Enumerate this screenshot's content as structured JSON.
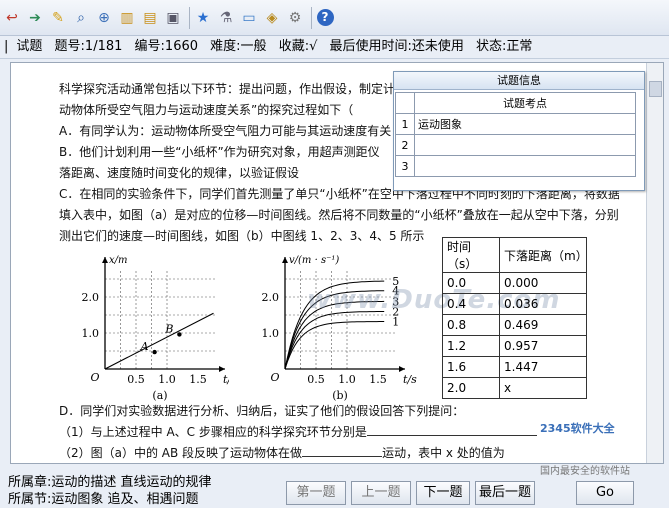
{
  "toolbar": {
    "icons": [
      "exit-icon",
      "next-icon",
      "edit-icon",
      "search-icon",
      "zoom-icon",
      "books-icon",
      "book-icon",
      "copy-icon",
      "star-icon",
      "tool-icon",
      "monitor-icon",
      "box-icon",
      "gear-icon",
      "help-icon"
    ]
  },
  "infobar": {
    "type": "试题",
    "number": "题号:1/181",
    "id": "编号:1660",
    "difficulty": "难度:一般",
    "favorite": "收藏:√",
    "last_used": "最后使用时间:还未使用",
    "state": "状态:正常"
  },
  "question": {
    "lines": [
      "科学探究活动通常包括以下环节：提出问题，作出假设，制定计",
      "动物体所受空气阻力与运动速度关系”的探究过程如下（",
      "A．有同学认为：运动物体所受空气阻力可能与其运动速度有关",
      "B．他们计划利用一些“小纸杯”作为研究对象，用超声测距仪",
      "落距离、速度随时间变化的规律，以验证假设",
      "C．在相同的实验条件下，同学们首先测量了单只“小纸杯”在空中下落过程中不同时刻的下落距离，将数据",
      "填入表中，如图（a）是对应的位移—时间图线。然后将不同数量的“小纸杯”叠放在一起从空中下落，分别",
      "测出它们的速度—时间图线，如图（b）中图线 1、2、3、4、5 所示"
    ],
    "tail_lines": [
      "D．同学们对实验数据进行分析、归纳后，证实了他们的假设回答下列提问：",
      "（1）与上述过程中 A、C 步骤相应的科学探究环节分别是",
      "（2）图（a）中的 AB 段反映了运动物体在做",
      "运动，表中 x 处的值为"
    ]
  },
  "popup": {
    "title": "试题信息",
    "header": "试题考点",
    "rows": [
      {
        "n": "1",
        "v": "运动图象"
      },
      {
        "n": "2",
        "v": ""
      },
      {
        "n": "3",
        "v": ""
      }
    ]
  },
  "data_table": {
    "headers": [
      "时间（s）",
      "下落距离（m）"
    ],
    "rows": [
      [
        "0.0",
        "0.000"
      ],
      [
        "0.4",
        "0.036"
      ],
      [
        "0.8",
        "0.469"
      ],
      [
        "1.2",
        "0.957"
      ],
      [
        "1.6",
        "1.447"
      ],
      [
        "2.0",
        "x"
      ]
    ]
  },
  "chart_data": [
    {
      "type": "line",
      "caption": "(a)",
      "ylabel": "x/m",
      "xlabel": "t/s",
      "xticks": [
        "0.5",
        "1.0",
        "1.5"
      ],
      "yticks": [
        "1.0",
        "2.0"
      ],
      "origin": "O",
      "points": [
        {
          "name": "A",
          "x": 0.8,
          "y": 0.47
        },
        {
          "name": "B",
          "x": 1.2,
          "y": 0.96
        }
      ],
      "line": {
        "x": [
          0.0,
          1.75
        ],
        "y": [
          0.0,
          1.55
        ]
      }
    },
    {
      "type": "line",
      "caption": "(b)",
      "ylabel": "v/(m · s⁻¹)",
      "xlabel": "t/s",
      "xticks": [
        "0.5",
        "1.0",
        "1.5"
      ],
      "yticks": [
        "1.0",
        "2.0"
      ],
      "origin": "O",
      "series": [
        {
          "name": "1",
          "plateau": 1.32
        },
        {
          "name": "2",
          "plateau": 1.6
        },
        {
          "name": "3",
          "plateau": 1.88
        },
        {
          "name": "4",
          "plateau": 2.18
        },
        {
          "name": "5",
          "plateau": 2.45
        }
      ]
    }
  ],
  "watermark": "www.DuoTe.com",
  "logo": "2345软件大全",
  "logo_sub": "国内最安全的软件站",
  "status": {
    "chapter": "所属章:运动的描述 直线运动的规律",
    "section": "所属节:运动图象 追及、相遇问题"
  },
  "buttons": {
    "first": "第一题",
    "prev": "上一题",
    "next": "下一题",
    "last": "最后一题",
    "go": "Go"
  }
}
